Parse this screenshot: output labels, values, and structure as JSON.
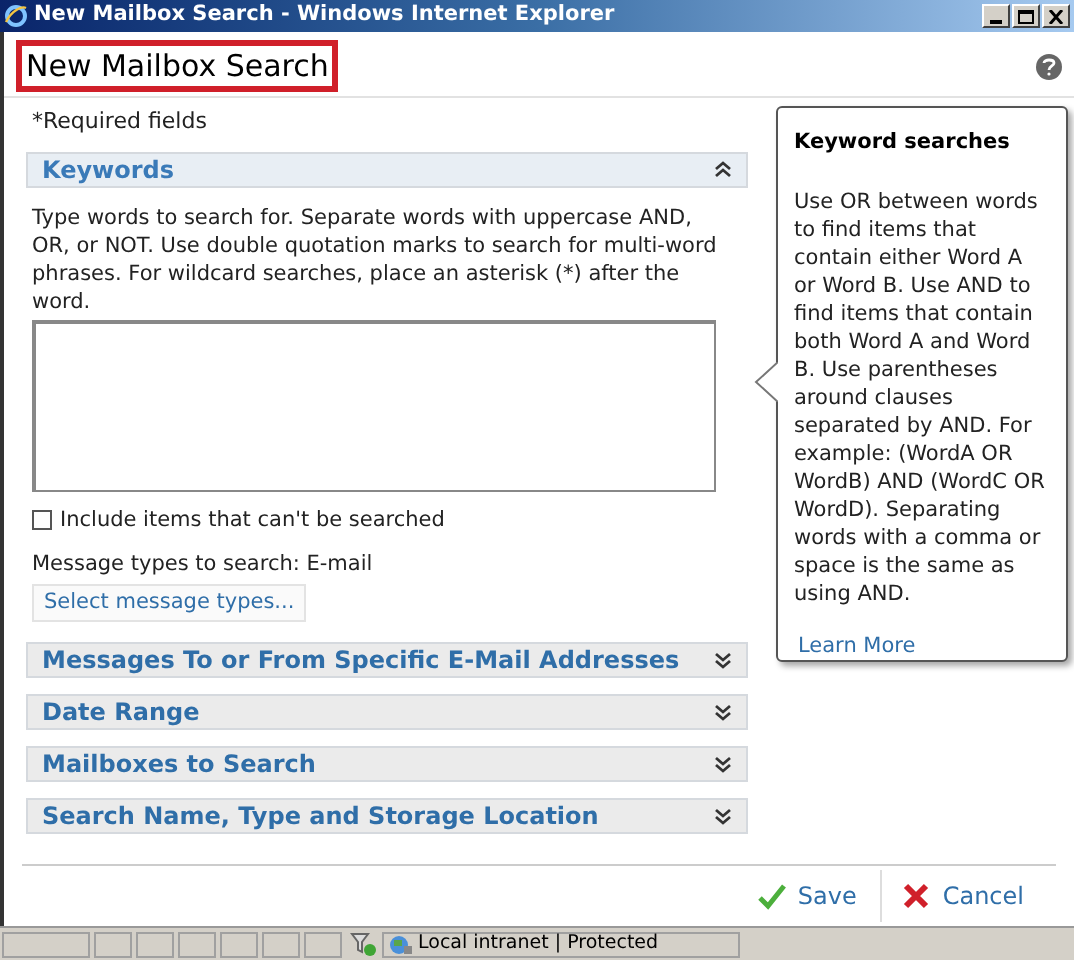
{
  "window": {
    "title": "New Mailbox Search - Windows Internet Explorer"
  },
  "page_title": "New Mailbox Search",
  "required_note": "*Required fields",
  "sections": [
    {
      "title": "Keywords",
      "expanded": true
    },
    {
      "title": "Messages To or From Specific E-Mail Addresses",
      "expanded": false
    },
    {
      "title": "Date Range",
      "expanded": false
    },
    {
      "title": "Mailboxes to Search",
      "expanded": false
    },
    {
      "title": "Search Name, Type and Storage Location",
      "expanded": false
    }
  ],
  "keywords": {
    "instructions": "Type words to search for. Separate words with uppercase AND, OR, or NOT. Use double quotation marks to search for multi-word phrases. For wildcard searches, place an asterisk (*) after the word.",
    "include_unsearchable": {
      "label": "Include items that can't be searched",
      "checked": false
    },
    "message_types": "Message types to search: E-mail",
    "select_button": "Select message types..."
  },
  "help_callout": {
    "title": "Keyword searches",
    "body": "Use OR between words to find items that contain either Word A or Word B. Use AND to find items that contain both Word A and Word B. Use parentheses around clauses separated by AND. For example: (WordA OR WordB) AND (WordC OR WordD). Separating words with a comma or space is the same as using AND.",
    "link": "Learn More"
  },
  "buttons": [
    {
      "kind": "save",
      "label": "Save"
    },
    {
      "kind": "cancel",
      "label": "Cancel"
    }
  ],
  "status_bar": {
    "zone": "Local intranet | Protected"
  }
}
